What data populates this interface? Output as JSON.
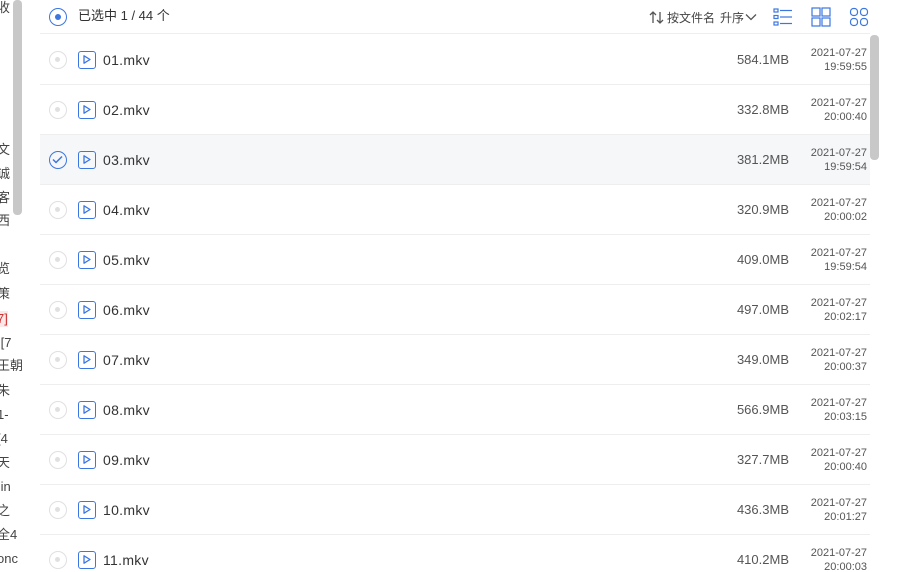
{
  "left_pane": {
    "fragments": [
      "收",
      "文",
      "诚",
      "客",
      "西",
      "览",
      "策",
      "7]",
      "][7",
      "王朝",
      "朱",
      "1-",
      "[4",
      "天",
      ".in",
      "之",
      "全4",
      "onc"
    ]
  },
  "header": {
    "selection_text": "已选中 1 / 44 个",
    "sort_label": "按文件名",
    "sort_order": "升序"
  },
  "files": [
    {
      "name": "01.mkv",
      "size": "584.1MB",
      "date": "2021-07-27",
      "time": "19:59:55",
      "selected": false
    },
    {
      "name": "02.mkv",
      "size": "332.8MB",
      "date": "2021-07-27",
      "time": "20:00:40",
      "selected": false
    },
    {
      "name": "03.mkv",
      "size": "381.2MB",
      "date": "2021-07-27",
      "time": "19:59:54",
      "selected": true
    },
    {
      "name": "04.mkv",
      "size": "320.9MB",
      "date": "2021-07-27",
      "time": "20:00:02",
      "selected": false
    },
    {
      "name": "05.mkv",
      "size": "409.0MB",
      "date": "2021-07-27",
      "time": "19:59:54",
      "selected": false
    },
    {
      "name": "06.mkv",
      "size": "497.0MB",
      "date": "2021-07-27",
      "time": "20:02:17",
      "selected": false
    },
    {
      "name": "07.mkv",
      "size": "349.0MB",
      "date": "2021-07-27",
      "time": "20:00:37",
      "selected": false
    },
    {
      "name": "08.mkv",
      "size": "566.9MB",
      "date": "2021-07-27",
      "time": "20:03:15",
      "selected": false
    },
    {
      "name": "09.mkv",
      "size": "327.7MB",
      "date": "2021-07-27",
      "time": "20:00:40",
      "selected": false
    },
    {
      "name": "10.mkv",
      "size": "436.3MB",
      "date": "2021-07-27",
      "time": "20:01:27",
      "selected": false
    },
    {
      "name": "11.mkv",
      "size": "410.2MB",
      "date": "2021-07-27",
      "time": "20:00:03",
      "selected": false
    }
  ],
  "colors": {
    "accent": "#3b76e1",
    "selected_row_bg": "#f6f7f9",
    "divider": "#eeeeee"
  }
}
